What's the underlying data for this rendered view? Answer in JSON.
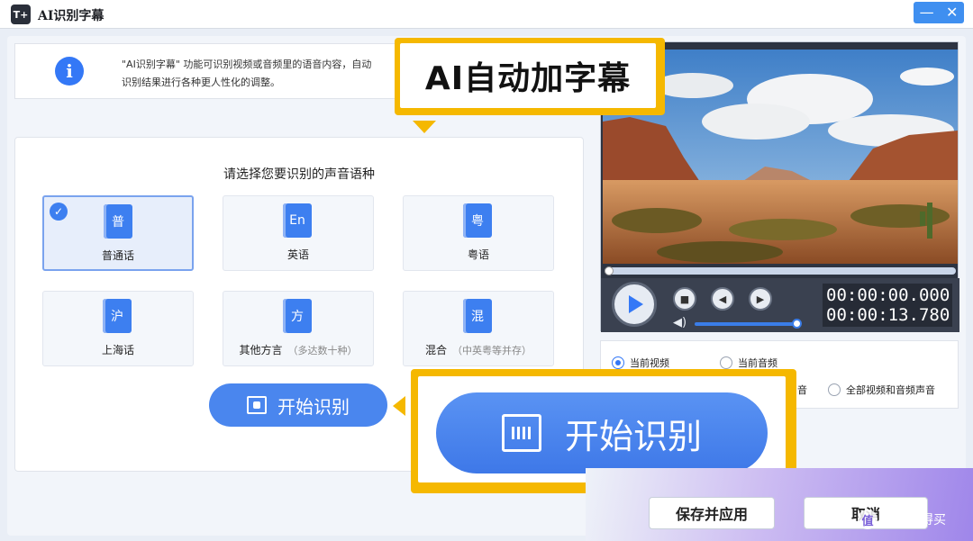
{
  "window": {
    "title": "AI识别字幕",
    "app_icon": "T+",
    "minimize_glyph": "—",
    "close_glyph": "✕"
  },
  "info": {
    "icon_glyph": "i",
    "line1": "\"AI识别字幕\" 功能可识别视频或音频里的语音内容，自动",
    "line2": "识别结果进行各种更人性化的调整。"
  },
  "callouts": {
    "top_label": "AI自动加字幕",
    "bottom_button_label": "开始识别"
  },
  "language_panel": {
    "title": "请选择您要识别的声音语种",
    "cards": [
      {
        "glyph": "普",
        "label": "普通话",
        "sub": "",
        "selected": true
      },
      {
        "glyph": "En",
        "label": "英语",
        "sub": "",
        "selected": false
      },
      {
        "glyph": "粤",
        "label": "粤语",
        "sub": "",
        "selected": false
      },
      {
        "glyph": "沪",
        "label": "上海话",
        "sub": "",
        "selected": false
      },
      {
        "glyph": "方",
        "label": "其他方言",
        "sub": "（多达数十种）",
        "selected": false
      },
      {
        "glyph": "混",
        "label": "混合",
        "sub": "（中英粤等并存）",
        "selected": false
      }
    ],
    "check_glyph": "✓",
    "start_button_label": "开始识别"
  },
  "player": {
    "time_current": "00:00:00.000",
    "time_total": "00:00:13.780",
    "progress": 0,
    "volume": 0.95,
    "stop_glyph": "■",
    "prev_glyph": "◀",
    "next_glyph": "▶",
    "volume_glyph": "◀)"
  },
  "options": {
    "radio_current_video": "当前视频",
    "radio_current_audio": "当前音频",
    "radio_partial_suffix": "音",
    "radio_all": "全部视频和音频声音",
    "selected": "当前视频"
  },
  "footer": {
    "save_label": "保存并应用",
    "cancel_label": "取消",
    "watermark_text": "什么值得买",
    "watermark_logo": "值"
  },
  "colors": {
    "accent": "#3478f6",
    "callout": "#f5b800"
  }
}
